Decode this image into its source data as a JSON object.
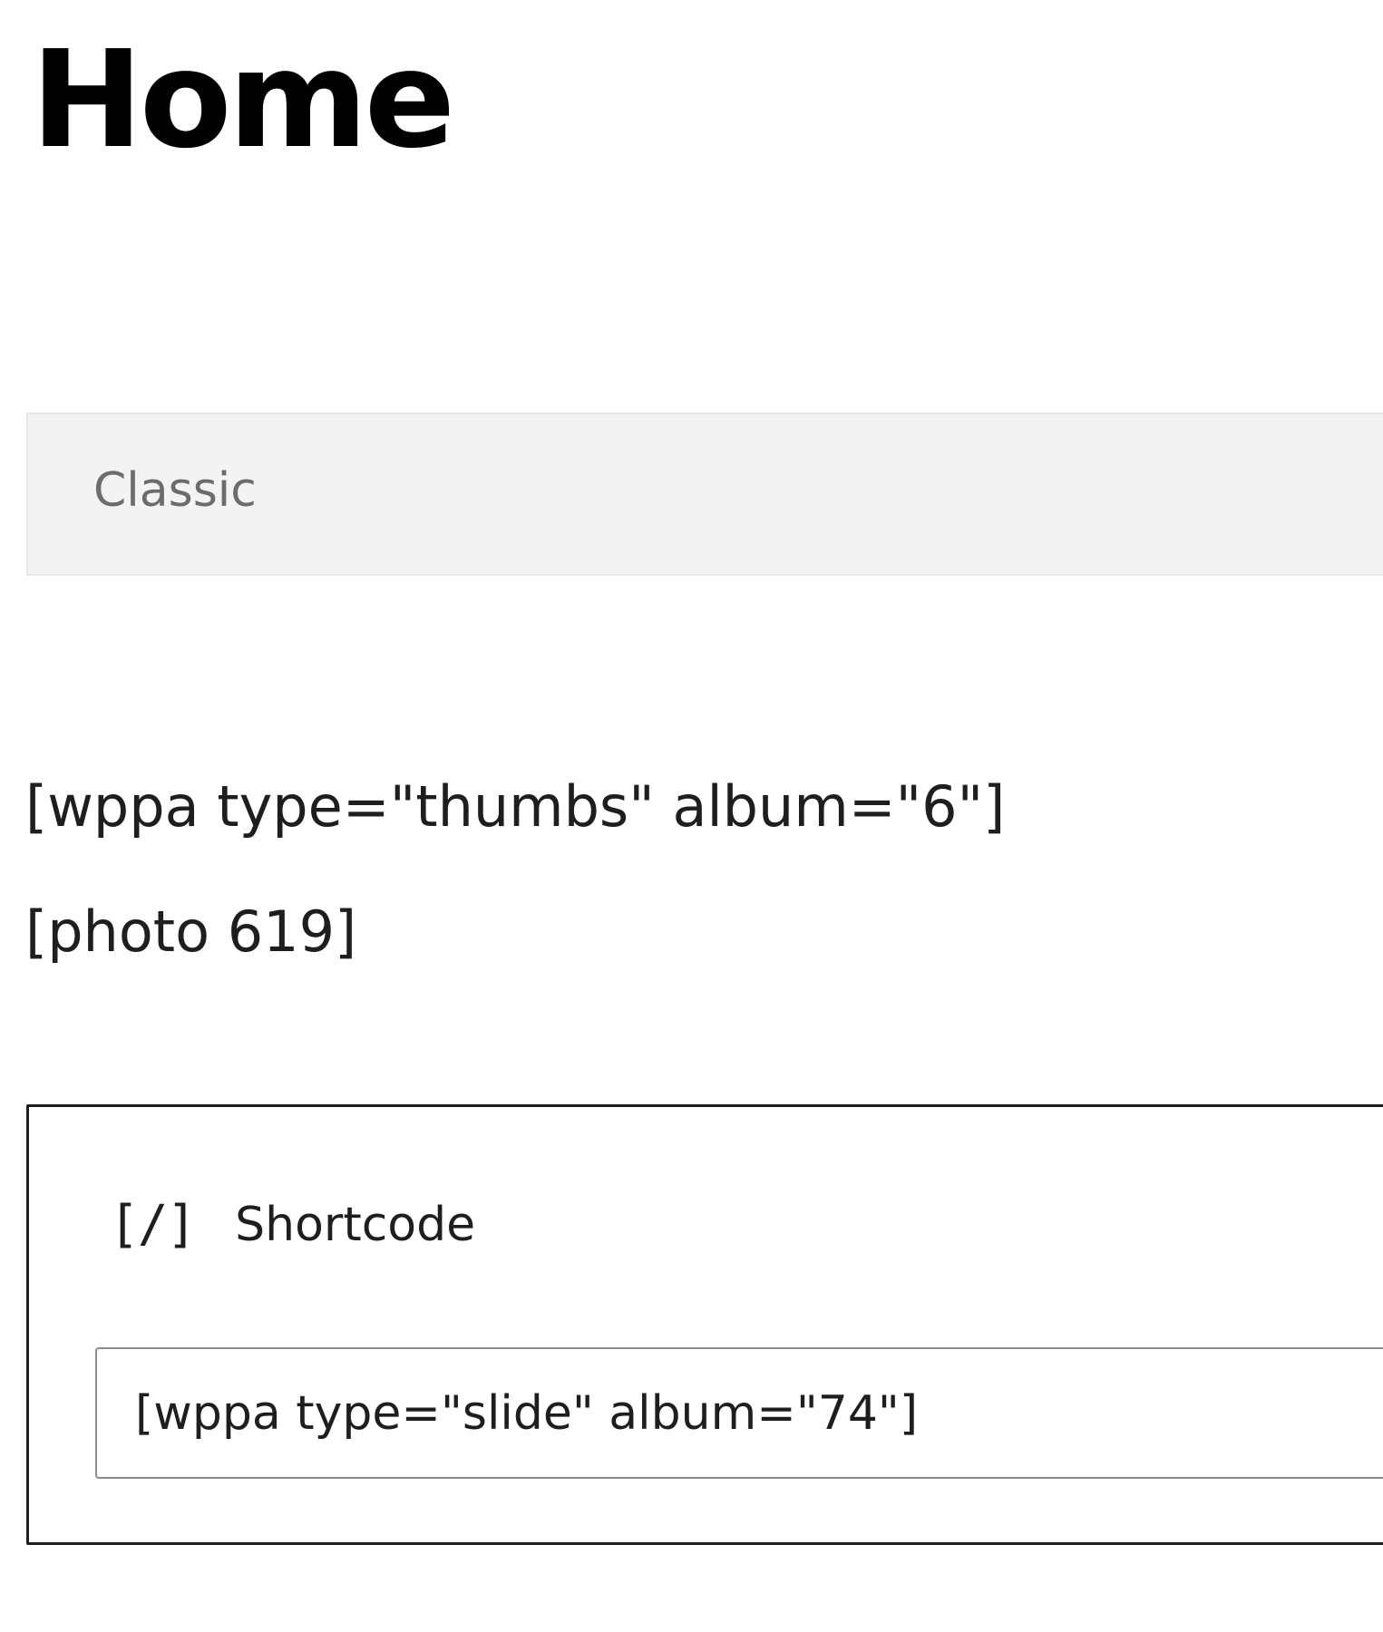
{
  "page": {
    "title": "Home"
  },
  "classic_block": {
    "label": "Classic"
  },
  "content": {
    "lines": [
      "[wppa type=\"thumbs\" album=\"6\"]",
      "[photo 619]"
    ]
  },
  "shortcode_block": {
    "icon": "shortcode-icon",
    "icon_glyph": "[/]",
    "label": "Shortcode",
    "value": "[wppa type=\"slide\" album=\"74\"]"
  }
}
